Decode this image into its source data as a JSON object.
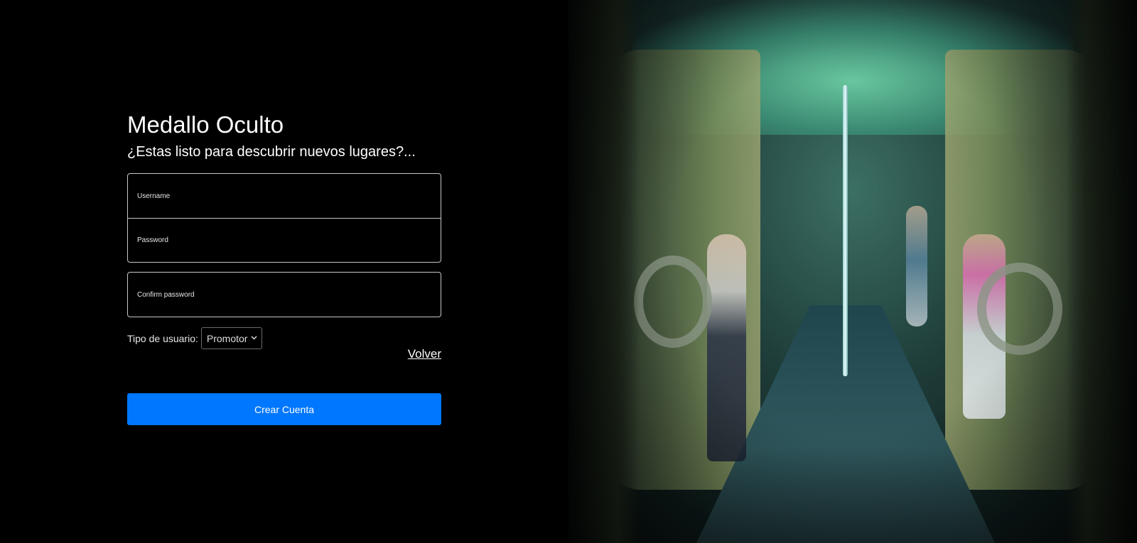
{
  "brand": {
    "title": "Medallo Oculto",
    "subtitle": "¿Estas listo para descubrir nuevos lugares?..."
  },
  "form": {
    "username_placeholder": "Username",
    "password_placeholder": "Password",
    "confirm_placeholder": "Confirm password",
    "user_type_label": "Tipo de usuario:",
    "user_type_selected": "Promotor",
    "back_link": "Volver",
    "submit_label": "Crear Cuenta"
  },
  "colors": {
    "accent": "#0077ff",
    "background": "#000000"
  },
  "icons": {
    "select_chevron": "chevron-down-icon"
  }
}
